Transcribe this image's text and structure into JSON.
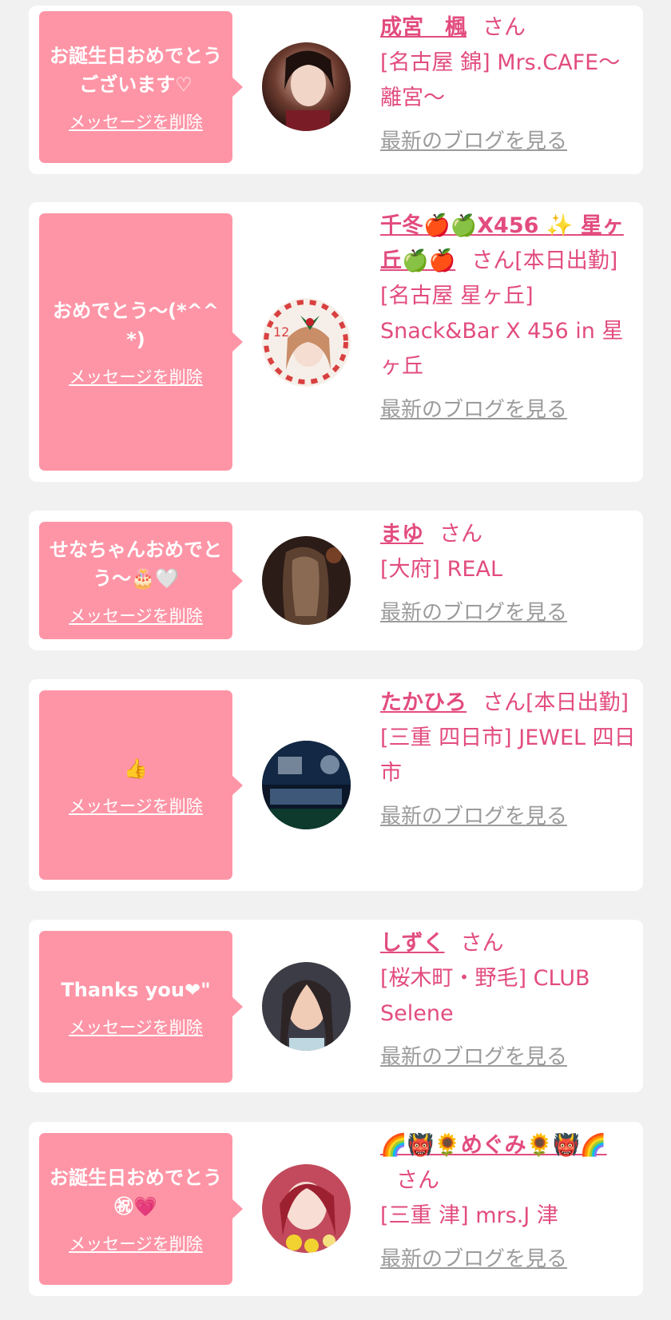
{
  "common": {
    "san": "さん",
    "delete_label": "メッセージを削除",
    "blog_label": "最新のブログを見る"
  },
  "entries": [
    {
      "message": "お誕生日おめでとうございます♡",
      "name": "成宮　楓",
      "status": "",
      "shop": "[名古屋 錦] Mrs.CAFE～離宮～"
    },
    {
      "message": "おめでとう～(*^^*)",
      "name": "千冬🍎🍏X456 ✨ 星ヶ丘🍏🍎",
      "status": "[本日出勤]",
      "shop": "[名古屋 星ヶ丘] Snack&Bar X 456 in 星ヶ丘"
    },
    {
      "message": "せなちゃんおめでとう～🎂🤍",
      "name": "まゆ",
      "status": "",
      "shop": "[大府] REAL"
    },
    {
      "message": "👍",
      "name": "たかひろ",
      "status": "[本日出勤]",
      "shop": "[三重 四日市] JEWEL 四日市"
    },
    {
      "message": "Thanks you❤\"",
      "name": "しずく",
      "status": "",
      "shop": "[桜木町・野毛] CLUB Selene"
    },
    {
      "message": "お誕生日おめでとう㊗💗",
      "name": "🌈👹🌻めぐみ🌻👹🌈",
      "status": "",
      "shop": "[三重 津] mrs.J 津"
    }
  ],
  "colors": {
    "bubble": "#fe95a6",
    "name": "#e24c7e",
    "link_gray": "#9b9b9b",
    "background": "#f1f1f1"
  }
}
